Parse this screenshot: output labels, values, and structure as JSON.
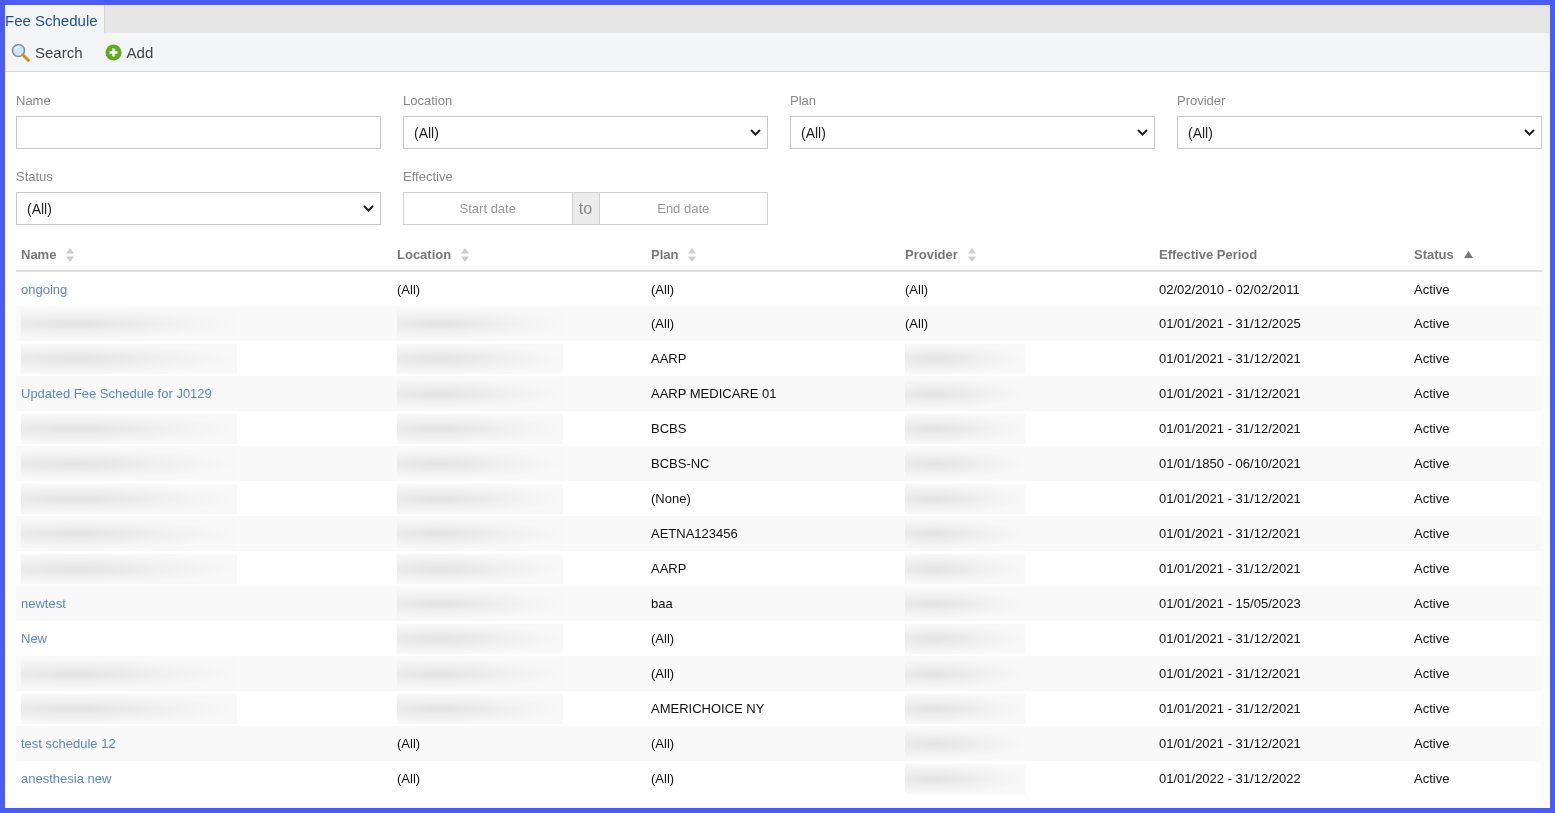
{
  "tabs": [
    {
      "label": "Fee Schedule",
      "selected": true
    }
  ],
  "toolbar": [
    {
      "kind": "search",
      "label": "Search"
    },
    {
      "kind": "add",
      "label": "Add"
    }
  ],
  "filters": [
    {
      "kind": "text",
      "label": "Name"
    },
    {
      "kind": "select",
      "label": "Location",
      "value": "(All)"
    },
    {
      "kind": "select",
      "label": "Plan",
      "value": "(All)"
    },
    {
      "kind": "select",
      "label": "Provider",
      "value": "(All)"
    },
    {
      "kind": "select",
      "label": "Status",
      "value": "(All)"
    },
    {
      "kind": "daterange",
      "label": "Effective",
      "start_placeholder": "Start date",
      "separator": "to",
      "end_placeholder": "End date"
    }
  ],
  "table": {
    "columns": [
      {
        "label": "Name",
        "kind": "link",
        "sortable": true,
        "sorted": false
      },
      {
        "label": "Location",
        "kind": "text",
        "sortable": true,
        "sorted": false
      },
      {
        "label": "Plan",
        "kind": "text",
        "sortable": true,
        "sorted": false
      },
      {
        "label": "Provider",
        "kind": "text",
        "sortable": true,
        "sorted": false
      },
      {
        "label": "Effective Period",
        "kind": "text",
        "sortable": false,
        "sorted": false
      },
      {
        "label": "Status",
        "kind": "text",
        "sortable": true,
        "sorted": true
      }
    ],
    "rows": [
      {
        "cells": [
          "ongoing",
          "(All)",
          "(All)",
          "(All)",
          "02/02/2010 - 02/02/2011",
          "Active"
        ]
      },
      {
        "cells": [
          null,
          null,
          "(All)",
          "(All)",
          "01/01/2021 - 31/12/2025",
          "Active"
        ]
      },
      {
        "cells": [
          null,
          null,
          "AARP",
          null,
          "01/01/2021 - 31/12/2021",
          "Active"
        ]
      },
      {
        "cells": [
          "Updated Fee Schedule for J0129",
          null,
          "AARP MEDICARE 01",
          null,
          "01/01/2021 - 31/12/2021",
          "Active"
        ]
      },
      {
        "cells": [
          null,
          null,
          "BCBS",
          null,
          "01/01/2021 - 31/12/2021",
          "Active"
        ]
      },
      {
        "cells": [
          null,
          null,
          "BCBS-NC",
          null,
          "01/01/1850 - 06/10/2021",
          "Active"
        ]
      },
      {
        "cells": [
          null,
          null,
          "(None)",
          null,
          "01/01/2021 - 31/12/2021",
          "Active"
        ]
      },
      {
        "cells": [
          null,
          null,
          "AETNA123456",
          null,
          "01/01/2021 - 31/12/2021",
          "Active"
        ]
      },
      {
        "cells": [
          null,
          null,
          "AARP",
          null,
          "01/01/2021 - 31/12/2021",
          "Active"
        ]
      },
      {
        "cells": [
          "newtest",
          null,
          "baa",
          null,
          "01/01/2021 - 15/05/2023",
          "Active"
        ]
      },
      {
        "cells": [
          "New",
          null,
          "(All)",
          null,
          "01/01/2021 - 31/12/2021",
          "Active"
        ]
      },
      {
        "cells": [
          null,
          null,
          "(All)",
          null,
          "01/01/2021 - 31/12/2021",
          "Active"
        ]
      },
      {
        "cells": [
          null,
          null,
          "AMERICHOICE NY",
          null,
          "01/01/2021 - 31/12/2021",
          "Active"
        ]
      },
      {
        "cells": [
          "test schedule 12",
          "(All)",
          "(All)",
          null,
          "01/01/2021 - 31/12/2021",
          "Active"
        ]
      },
      {
        "cells": [
          "anesthesia new",
          "(All)",
          "(All)",
          null,
          "01/01/2022 - 31/12/2022",
          "Active"
        ]
      }
    ]
  }
}
